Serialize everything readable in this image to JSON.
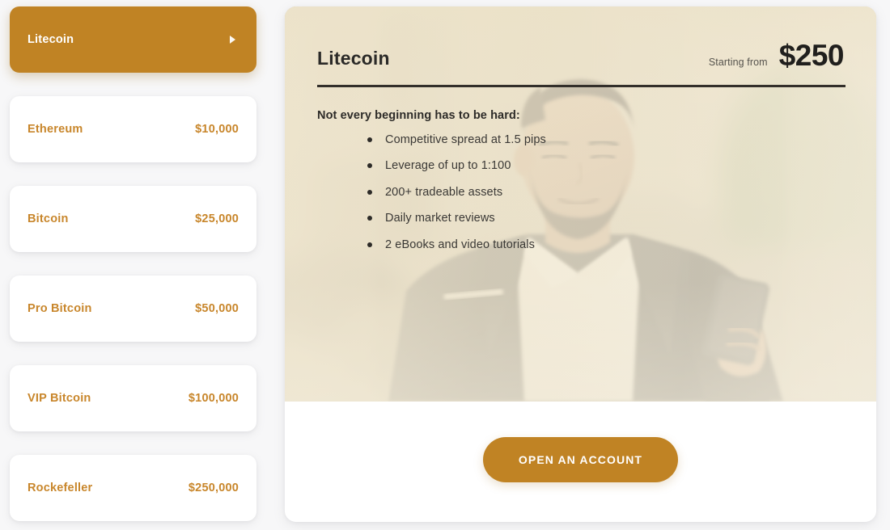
{
  "colors": {
    "accent": "#c08324",
    "accent_text": "#c8862b",
    "page_bg": "#f7f7f8",
    "card_bg": "#ffffff",
    "hero_overlay": "#f0e7d0",
    "heading": "#2b2a28"
  },
  "sidebar": {
    "items": [
      {
        "name": "Litecoin",
        "price": "",
        "active": true,
        "arrow": "chevron-right-icon"
      },
      {
        "name": "Ethereum",
        "price": "$10,000",
        "active": false,
        "arrow": ""
      },
      {
        "name": "Bitcoin",
        "price": "$25,000",
        "active": false,
        "arrow": ""
      },
      {
        "name": "Pro Bitcoin",
        "price": "$50,000",
        "active": false,
        "arrow": ""
      },
      {
        "name": "VIP Bitcoin",
        "price": "$100,000",
        "active": false,
        "arrow": ""
      },
      {
        "name": "Rockefeller",
        "price": "$250,000",
        "active": false,
        "arrow": ""
      }
    ]
  },
  "hero": {
    "title": "Litecoin",
    "price_label": "Starting from",
    "price_value": "$250",
    "subtitle": "Not every beginning has to be hard:",
    "features": [
      "Competitive spread at 1.5 pips",
      "Leverage of up to 1:100",
      "200+ tradeable assets",
      "Daily market reviews",
      "2 eBooks and video tutorials"
    ],
    "image_alt": "bearded-man-in-suit-looking-at-phone"
  },
  "footer": {
    "cta_label": "OPEN AN ACCOUNT"
  }
}
